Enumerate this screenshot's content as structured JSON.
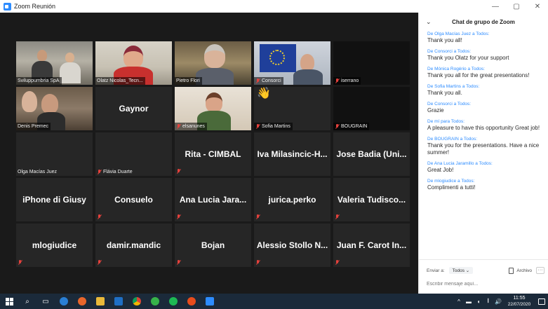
{
  "window": {
    "title": "Zoom Reunión",
    "minimize": "—",
    "maximize": "▢",
    "close": "✕"
  },
  "tiles": [
    {
      "id": "sviluppumbria",
      "label": "Sviluppumbria SpA",
      "video": "office",
      "muted": false
    },
    {
      "id": "olatz",
      "label": "Olatz Nicolas_Tecn...",
      "video": "olatz",
      "muted": false,
      "active": true
    },
    {
      "id": "pietro",
      "label": "Pietro Flori",
      "video": "pietro",
      "muted": false
    },
    {
      "id": "consorci-video",
      "label": "Consorci",
      "video": "consorci",
      "muted": true
    },
    {
      "id": "iserrano",
      "label": "iserrano",
      "video": "black",
      "muted": true
    },
    {
      "id": "denis",
      "label": "Denis Premec",
      "video": "denis",
      "muted": false
    },
    {
      "id": "gaynor",
      "name": "Gaynor",
      "muted": false
    },
    {
      "id": "elsanunes",
      "label": "elsanunes",
      "video": "elsa",
      "muted": true
    },
    {
      "id": "sofia",
      "label": "Sofia Martins",
      "video": "wave",
      "muted": true
    },
    {
      "id": "bougrain",
      "label": "BOUGRAIN",
      "video": "black",
      "muted": true
    },
    {
      "id": "olga",
      "label": "Olga Macías Juez",
      "muted": false,
      "plainLabel": true
    },
    {
      "id": "flavia",
      "label": "Flávia Duarte",
      "muted": true,
      "plainLabel": true
    },
    {
      "id": "rita",
      "name": "Rita - CIMBAL",
      "muted": true
    },
    {
      "id": "iva",
      "name": "Iva Milasincic-H...",
      "muted": false
    },
    {
      "id": "jose",
      "name": "Jose Badia (Uni...",
      "muted": false
    },
    {
      "id": "giusy",
      "name": "iPhone di Giusy",
      "muted": false
    },
    {
      "id": "consuelo",
      "name": "Consuelo",
      "muted": true
    },
    {
      "id": "analucia",
      "name": "Ana Lucia Jara...",
      "muted": true
    },
    {
      "id": "jurica",
      "name": "jurica.perko",
      "muted": true
    },
    {
      "id": "valeria",
      "name": "Valeria Tudisco...",
      "muted": true
    },
    {
      "id": "mlogiudice",
      "name": "mlogiudice",
      "muted": true
    },
    {
      "id": "damir",
      "name": "damir.mandic",
      "muted": true
    },
    {
      "id": "bojan",
      "name": "Bojan",
      "muted": true
    },
    {
      "id": "alessio",
      "name": "Alessio Stollo N...",
      "muted": true
    },
    {
      "id": "juan",
      "name": "Juan F. Carot In...",
      "muted": true
    }
  ],
  "chat": {
    "collapse_icon": "chevron-down-icon",
    "title": "Chat de grupo de Zoom",
    "messages": [
      {
        "prefix": "De ",
        "sender": "Olga Macías Juez",
        "middle": " a ",
        "to": "Todos",
        "suffix": ":",
        "text": "Thank you all!"
      },
      {
        "prefix": "De ",
        "sender": "Consorci",
        "middle": " a ",
        "to": "Todos",
        "suffix": ":",
        "text": "Thank you Olatz for your support"
      },
      {
        "prefix": "De ",
        "sender": "Mónica Rogério",
        "middle": " a ",
        "to": "Todos",
        "suffix": ":",
        "text": "Thank you all for the great presentations!"
      },
      {
        "prefix": "De ",
        "sender": "Sofia Martins",
        "middle": " a ",
        "to": "Todos",
        "suffix": ":",
        "text": "Thank you all."
      },
      {
        "prefix": "De ",
        "sender": "Consorci",
        "middle": " a ",
        "to": "Todos",
        "suffix": ":",
        "text": "Grazie"
      },
      {
        "prefix": "De ",
        "sender": "mí",
        "middle": " para ",
        "to": "Todos",
        "suffix": ":",
        "text": "A pleasure to have this opportunity Great job!"
      },
      {
        "prefix": "De ",
        "sender": "BOUGRAIN",
        "middle": " a ",
        "to": "Todos",
        "suffix": ":",
        "text": "Thank you for the presentations. Have a nice summer!"
      },
      {
        "prefix": "De ",
        "sender": "Ana Lucia Jaramillo",
        "middle": " a ",
        "to": "Todos",
        "suffix": ":",
        "text": "Great Job!"
      },
      {
        "prefix": "De ",
        "sender": "mlogiudice",
        "middle": " a ",
        "to": "Todos",
        "suffix": ":",
        "text": "Complimenti a tutti!"
      }
    ],
    "send_to_label": "Enviar a:",
    "send_to_value": "Todos ⌄",
    "file_label": "Archivo",
    "more_label": "···",
    "input_placeholder": "Escribir mensaje aquí..."
  },
  "taskbar": {
    "search_icon": "⌕",
    "taskview_icon": "▭",
    "tray_icons": [
      "^",
      "▬",
      "◖",
      "𝄃",
      "🔊"
    ],
    "time": "11:55",
    "date": "22/07/2020"
  },
  "colors": {
    "accent": "#2d8cff",
    "active_border": "#c9d44a",
    "muted_red": "#e5413c",
    "taskbar": "#1b2a3a"
  }
}
